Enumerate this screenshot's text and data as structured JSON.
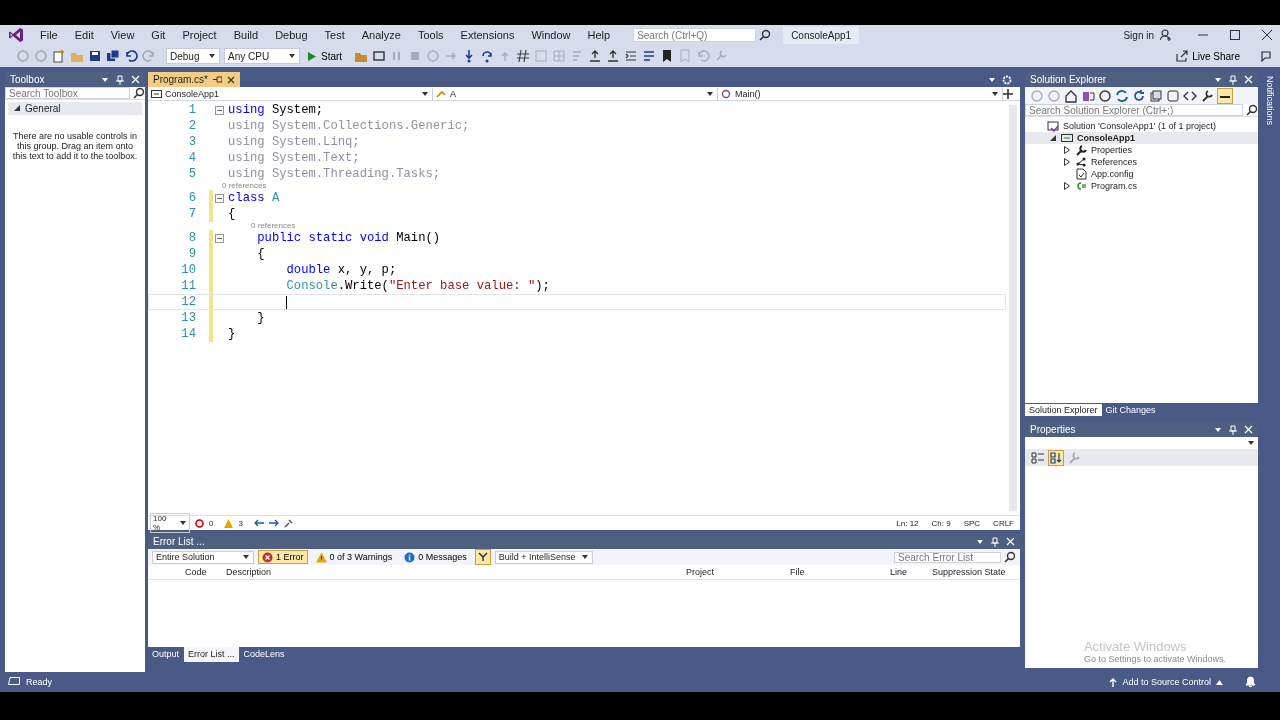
{
  "menu": [
    "File",
    "Edit",
    "View",
    "Git",
    "Project",
    "Build",
    "Debug",
    "Test",
    "Analyze",
    "Tools",
    "Extensions",
    "Window",
    "Help"
  ],
  "search": {
    "placeholder": "Search (Ctrl+Q)"
  },
  "solution_name": "ConsoleApp1",
  "sign_in": "Sign in",
  "toolbar": {
    "configuration": "Debug",
    "platform": "Any CPU",
    "start": "Start",
    "live_share": "Live Share"
  },
  "toolbox": {
    "title": "Toolbox",
    "search": {
      "placeholder": "Search Toolbox"
    },
    "group": {
      "label": "General",
      "expanded": true
    },
    "message": "There are no usable controls in this group. Drag an item onto this text to add it to the toolbox."
  },
  "editor": {
    "tabs": [
      {
        "label": "Program.cs*",
        "selected": true
      }
    ],
    "navigation": {
      "project": "ConsoleApp1",
      "type": "A",
      "member": "Main()"
    },
    "lines": [
      {
        "number": "1",
        "collapsible": true,
        "tokens": [
          {
            "kind": "keyword",
            "text": "using"
          },
          {
            "kind": "plain",
            "text": " System;"
          }
        ]
      },
      {
        "number": "2",
        "tokens": [
          {
            "kind": "unused",
            "text": "using System.Collections.Generic;"
          }
        ]
      },
      {
        "number": "3",
        "tokens": [
          {
            "kind": "unused",
            "text": "using System.Linq;"
          }
        ]
      },
      {
        "number": "4",
        "tokens": [
          {
            "kind": "unused",
            "text": "using System.Text;"
          }
        ]
      },
      {
        "number": "5",
        "tokens": [
          {
            "kind": "unused",
            "text": "using System.Threading.Tasks;"
          }
        ]
      },
      {
        "number": "6",
        "collapsible": true,
        "codelens": "0 references",
        "tokens": [
          {
            "kind": "keyword",
            "text": "class "
          },
          {
            "kind": "type",
            "text": "A"
          }
        ]
      },
      {
        "number": "7",
        "tokens": [
          {
            "kind": "plain",
            "text": "{"
          }
        ]
      },
      {
        "number": "8",
        "collapsible": true,
        "codelens": "0 references",
        "tokens": [
          {
            "kind": "keyword",
            "text": "    public static void"
          },
          {
            "kind": "plain",
            "text": " Main()"
          }
        ]
      },
      {
        "number": "9",
        "tokens": [
          {
            "kind": "plain",
            "text": "    {"
          }
        ]
      },
      {
        "number": "10",
        "tokens": [
          {
            "kind": "keyword",
            "text": "        double"
          },
          {
            "kind": "plain",
            "text": " x, y, p;"
          }
        ]
      },
      {
        "number": "11",
        "tokens": [
          {
            "kind": "type",
            "text": "        Console"
          },
          {
            "kind": "plain",
            "text": ".Write("
          },
          {
            "kind": "string",
            "text": "\"Enter base value: \""
          },
          {
            "kind": "plain",
            "text": ");"
          }
        ]
      },
      {
        "number": "12",
        "current": true
      },
      {
        "number": "13",
        "tokens": [
          {
            "kind": "plain",
            "text": "    }"
          }
        ]
      },
      {
        "number": "14",
        "tokens": [
          {
            "kind": "plain",
            "text": "}"
          }
        ]
      }
    ],
    "status": {
      "zoom": "100 %",
      "errors": "0",
      "warnings": "3",
      "line": "Ln: 12",
      "column": "Ch: 9",
      "whitespace": "SPC",
      "line_ending": "CRLF"
    }
  },
  "error_list": {
    "title": "Error List ...",
    "scope": "Entire Solution",
    "filters": [
      {
        "kind": "error",
        "label": "1 Error",
        "selected": true
      },
      {
        "kind": "warning",
        "label": "0 of 3 Warnings",
        "selected": false
      },
      {
        "kind": "info",
        "label": "0 Messages",
        "selected": false
      }
    ],
    "source": "Build + IntelliSense",
    "search": {
      "placeholder": "Search Error List"
    },
    "columns": [
      "Code",
      "Description",
      "Project",
      "File",
      "Line",
      "Suppression State"
    ]
  },
  "bottom_tabs": [
    {
      "label": "Output",
      "selected": false
    },
    {
      "label": "Error List ...",
      "selected": true
    },
    {
      "label": "CodeLens",
      "selected": false
    }
  ],
  "solution_explorer": {
    "title": "Solution Explorer",
    "search": {
      "placeholder": "Search Solution Explorer (Ctrl+;)"
    },
    "tree": [
      {
        "kind": "solution",
        "label": "Solution 'ConsoleApp1' (1 of 1 project)",
        "selected": false,
        "children": [
          {
            "kind": "project",
            "label": "ConsoleApp1",
            "expanded": true,
            "selected": true,
            "children": [
              {
                "kind": "properties",
                "label": "Properties",
                "expanded": false,
                "selected": false
              },
              {
                "kind": "references",
                "label": "References",
                "expanded": false,
                "selected": false
              },
              {
                "kind": "config",
                "label": "App.config",
                "selected": false
              },
              {
                "kind": "csharp",
                "label": "Program.cs",
                "expanded": false,
                "selected": false
              }
            ]
          }
        ]
      }
    ],
    "tabs": [
      {
        "label": "Solution Explorer",
        "selected": true
      },
      {
        "label": "Git Changes",
        "selected": false
      }
    ]
  },
  "properties": {
    "title": "Properties"
  },
  "notifications": "Notifications",
  "activation": {
    "title": "Activate Windows",
    "message": "Go to Settings to activate Windows."
  },
  "status_bar": {
    "state": "Ready",
    "source_control": "Add to Source Control"
  }
}
